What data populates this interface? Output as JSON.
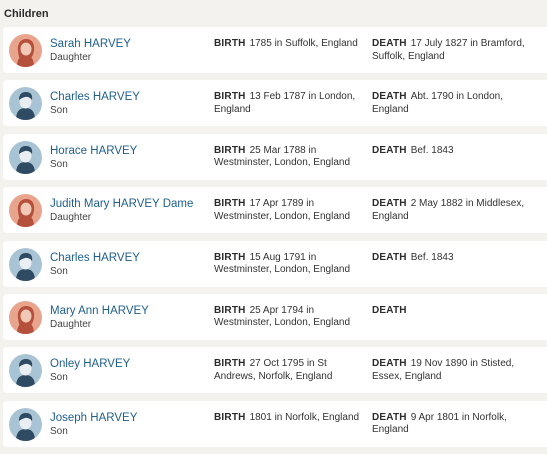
{
  "section": {
    "title": "Children"
  },
  "labels": {
    "birth": "BIRTH",
    "death": "DEATH"
  },
  "colors": {
    "female": "#e8a48c",
    "male": "#a8c4d4",
    "link": "#1f5f8b"
  },
  "children": [
    {
      "name": "Sarah HARVEY",
      "relation": "Daughter",
      "gender": "female",
      "birth": "1785 in Suffolk, England",
      "death": "17 July 1827 in Bramford, Suffolk, England"
    },
    {
      "name": "Charles HARVEY",
      "relation": "Son",
      "gender": "male",
      "birth": "13 Feb 1787 in London, England",
      "death": "Abt. 1790 in London, England"
    },
    {
      "name": "Horace HARVEY",
      "relation": "Son",
      "gender": "male",
      "birth": "25 Mar 1788 in Westminster, London, England",
      "death": "Bef. 1843"
    },
    {
      "name": "Judith Mary HARVEY Dame",
      "relation": "Daughter",
      "gender": "female",
      "birth": "17 Apr 1789 in Westminster, London, England",
      "death": "2 May 1882 in Middlesex, England"
    },
    {
      "name": "Charles HARVEY",
      "relation": "Son",
      "gender": "male",
      "birth": "15 Aug 1791 in Westminster, London, England",
      "death": "Bef. 1843"
    },
    {
      "name": "Mary Ann HARVEY",
      "relation": "Daughter",
      "gender": "female",
      "birth": "25 Apr 1794 in Westminster, London, England",
      "death": ""
    },
    {
      "name": "Onley HARVEY",
      "relation": "Son",
      "gender": "male",
      "birth": "27 Oct 1795 in St Andrews, Norfolk, England",
      "death": "19 Nov 1890 in Stisted, Essex, England"
    },
    {
      "name": "Joseph HARVEY",
      "relation": "Son",
      "gender": "male",
      "birth": "1801 in Norfolk, England",
      "death": "9 Apr 1801 in Norfolk, England"
    }
  ]
}
